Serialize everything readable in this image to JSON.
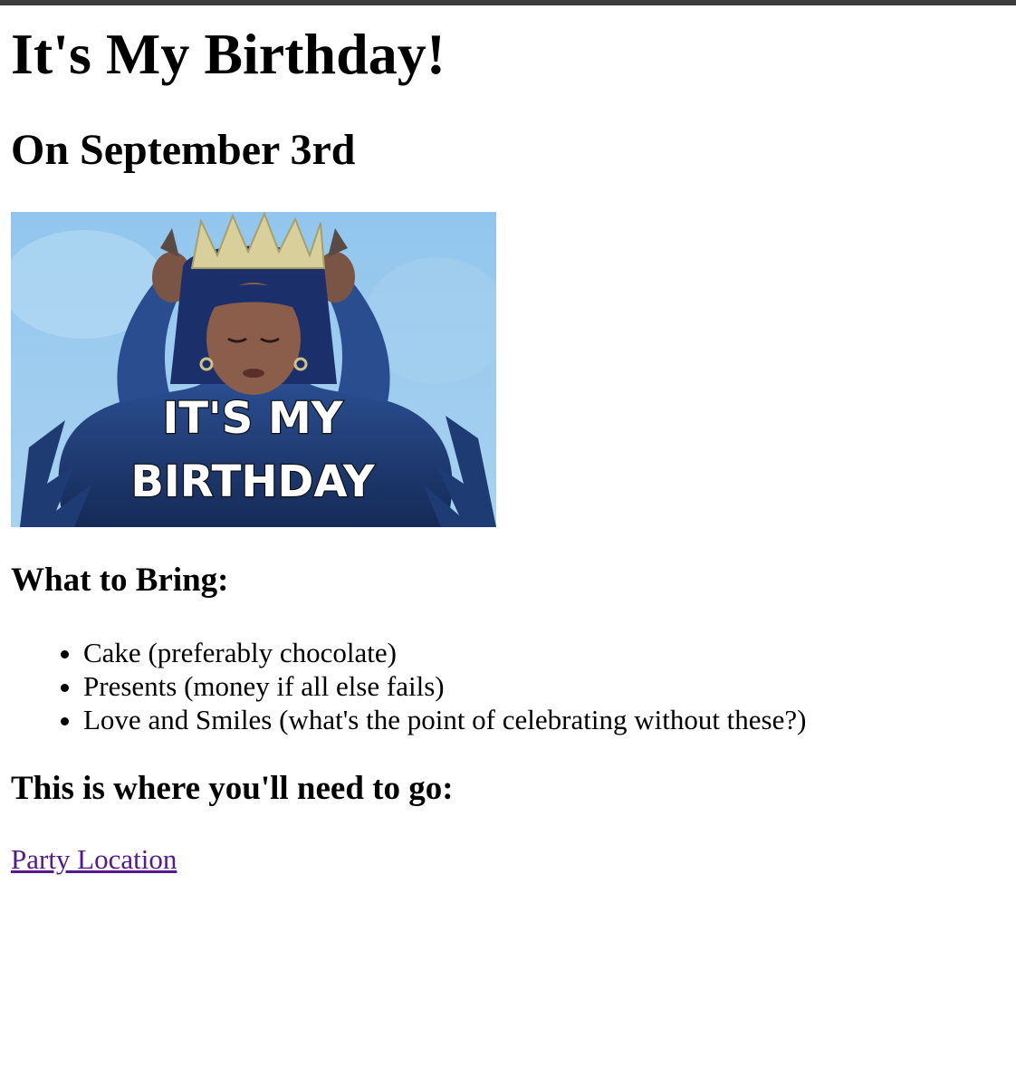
{
  "page": {
    "title": "It's My Birthday!",
    "subtitle": "On September 3rd"
  },
  "gif": {
    "caption_line1": "IT'S MY",
    "caption_line2": "BIRTHDAY"
  },
  "bring": {
    "heading": "What to Bring:",
    "items": [
      "Cake (preferably chocolate)",
      "Presents (money if all else fails)",
      "Love and Smiles (what's the point of celebrating without these?)"
    ]
  },
  "location": {
    "heading": "This is where you'll need to go:",
    "link_label": "Party Location",
    "link_color": "#551a8b"
  },
  "colors": {
    "top_bar": "#3d3d3d",
    "gif_sky": "#8fc3ea"
  }
}
